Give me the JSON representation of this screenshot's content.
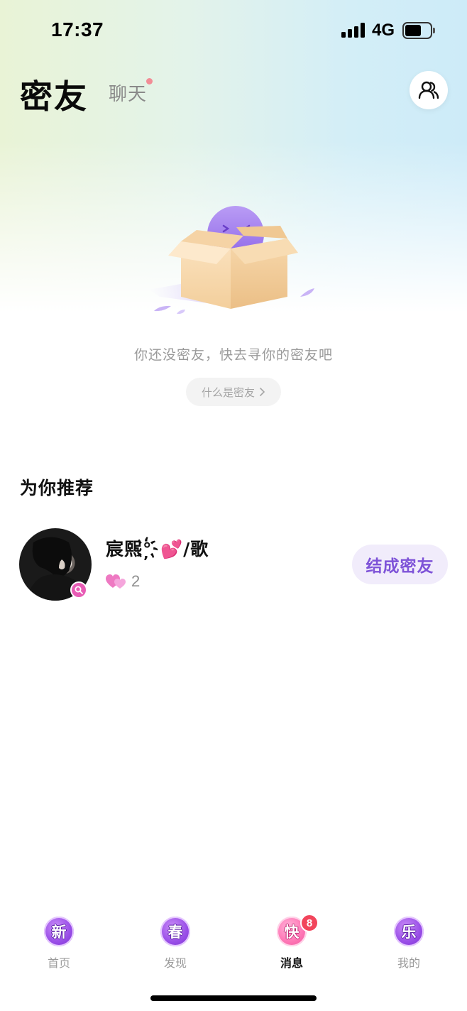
{
  "status_bar": {
    "time": "17:37",
    "network": "4G",
    "battery_level": 0.65
  },
  "header": {
    "title": "密友",
    "tab_chat": "聊天",
    "tab_chat_has_unread": true,
    "contacts_icon": "people-icon"
  },
  "empty_state": {
    "illustration": "open-box-icon",
    "message": "你还没密友，快去寻你的密友吧",
    "link_label": "什么是密友",
    "link_icon": "chevron-right-icon"
  },
  "recommend": {
    "heading": "为你推荐",
    "items": [
      {
        "name": "宸熙°҉💕/歌",
        "gender_icon": "female-icon",
        "intimacy_icon": "pink-hearts-icon",
        "intimacy_count": "2",
        "action_label": "结成密友"
      }
    ]
  },
  "tab_bar": {
    "items": [
      {
        "icon_char": "新",
        "label": "首页",
        "active": false
      },
      {
        "icon_char": "春",
        "label": "发现",
        "active": false
      },
      {
        "icon_char": "快",
        "label": "消息",
        "active": true,
        "badge": "8"
      },
      {
        "icon_char": "乐",
        "label": "我的",
        "active": false
      }
    ]
  },
  "colors": {
    "accent_purple": "#7e53d8",
    "button_bg": "#f1ecfb",
    "badge_red": "#f2455c",
    "unread_dot": "#f28d96"
  }
}
